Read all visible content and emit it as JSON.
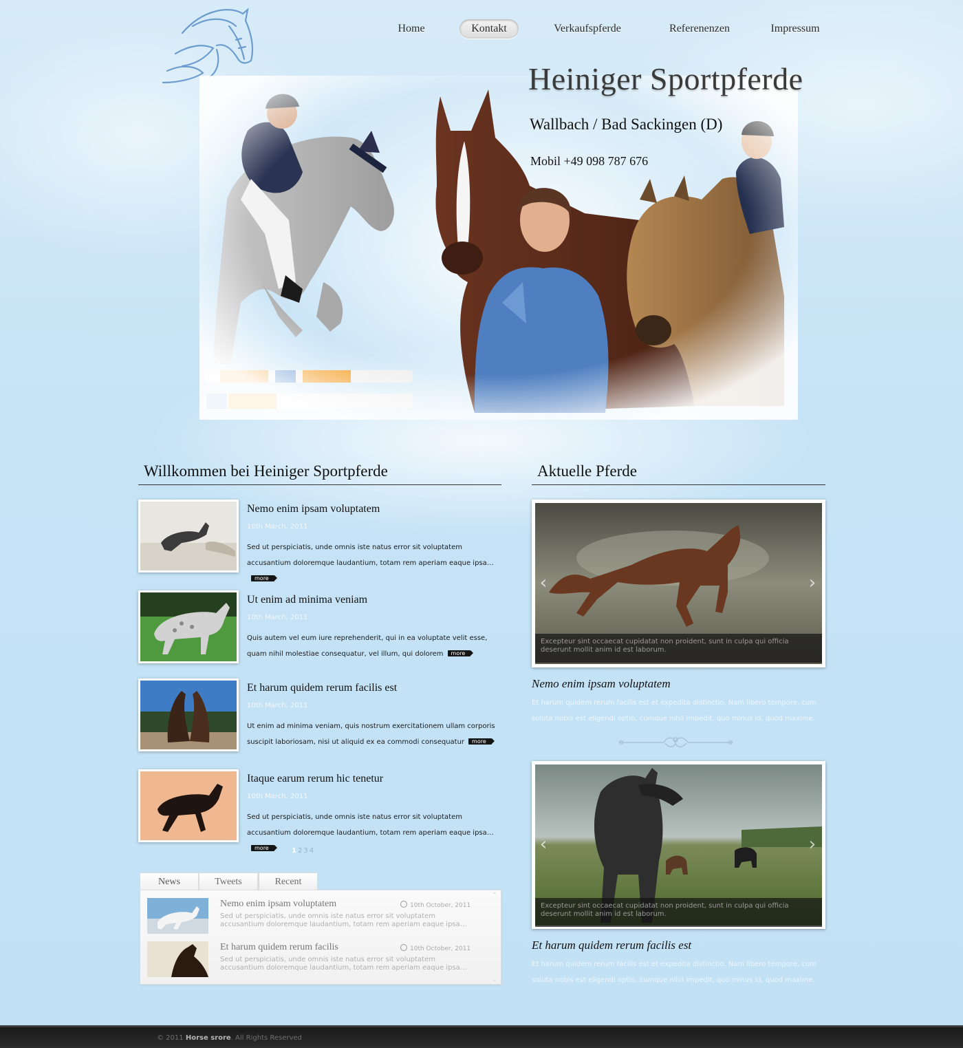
{
  "nav": {
    "items": [
      {
        "label": "Home"
      },
      {
        "label": "Kontakt"
      },
      {
        "label": "Verkaufspferde"
      },
      {
        "label": "Referenenzen"
      },
      {
        "label": "Impressum"
      }
    ],
    "active_index": 1
  },
  "hero": {
    "title": "Heiniger Sportpferde",
    "location": "Wallbach / Bad Sackingen (D)",
    "phone": "Mobil +49 098 787 676"
  },
  "welcome": {
    "heading": "Willkommen bei Heiniger Sportpferde",
    "items": [
      {
        "title": "Nemo enim ipsam voluptatem",
        "date": "10th March, 2011",
        "text": "Sed ut perspiciatis, unde omnis iste natus error sit voluptatem accusantium doloremque laudantium, totam rem aperiam eaque ipsa…",
        "more": "more"
      },
      {
        "title": "Ut enim ad minima veniam",
        "date": "10th March, 2011",
        "text": "Quis autem vel eum iure reprehenderit, qui in ea voluptate velit esse, quam nihil molestiae consequatur, vel illum, qui dolorem",
        "more": "more"
      },
      {
        "title": "Et harum quidem rerum facilis est",
        "date": "10th March, 2011",
        "text": "Ut enim ad minima veniam, quis nostrum exercitationem ullam corporis suscipit laboriosam, nisi ut aliquid ex ea commodi consequatur",
        "more": "more"
      },
      {
        "title": "Itaque earum rerum hic tenetur",
        "date": "10th March, 2011",
        "text": "Sed ut perspiciatis, unde omnis iste natus error sit voluptatem accusantium doloremque laudantium, totam rem aperiam eaque ipsa…",
        "more": "more"
      }
    ],
    "pages": [
      "1",
      "2",
      "3",
      "4"
    ],
    "current_page": "1"
  },
  "tabs": {
    "labels": [
      "News",
      "Tweets",
      "Recent"
    ],
    "active": "News",
    "items": [
      {
        "title": "Nemo enim ipsam voluptatem",
        "date": "10th October, 2011",
        "text": "Sed ut perspiciatis, unde omnis iste natus error sit voluptatem accusantium doloremque laudantium, totam rem aperiam eaque ipsa…"
      },
      {
        "title": "Et harum quidem rerum facilis",
        "date": "10th October, 2011",
        "text": "Sed ut perspiciatis, unde omnis iste natus error sit voluptatem accusantium doloremque laudantium, totam rem aperiam eaque ipsa…"
      }
    ]
  },
  "current": {
    "heading": "Aktuelle Pferde",
    "items": [
      {
        "caption": "Excepteur sint occaecat cupidatat non proident, sunt in culpa qui officia deserunt mollit anim id est laborum.",
        "title": "Nemo enim ipsam voluptatem",
        "text": "Et harum quidem rerum facilis est et expedita distinctio. Nam libero tempore, cum soluta nobis est eligendi optio, cumque nihil impedit, quo minus id, quod maxime."
      },
      {
        "caption": "Excepteur sint occaecat cupidatat non proident, sunt in culpa qui officia deserunt mollit anim id est laborum.",
        "title": "Et harum quidem rerum facilis est",
        "text": "Et harum quidem rerum facilis est et expedita distinctio. Nam libero tempore, cum soluta nobis est eligendi optio, cumque nihil impedit, quo minus id, quod maxime."
      }
    ]
  },
  "footer": {
    "copyright": "© 2011",
    "brand": "Horse srore",
    "rights": ". All Rights Reserved"
  },
  "icons": {
    "prev": "chevron-left-icon",
    "next": "chevron-right-icon",
    "clock": "clock-icon",
    "logo": "horse-head-logo"
  },
  "colors": {
    "sky": "#c6e3f6",
    "footer": "#222222",
    "accent_text": "#111111"
  }
}
